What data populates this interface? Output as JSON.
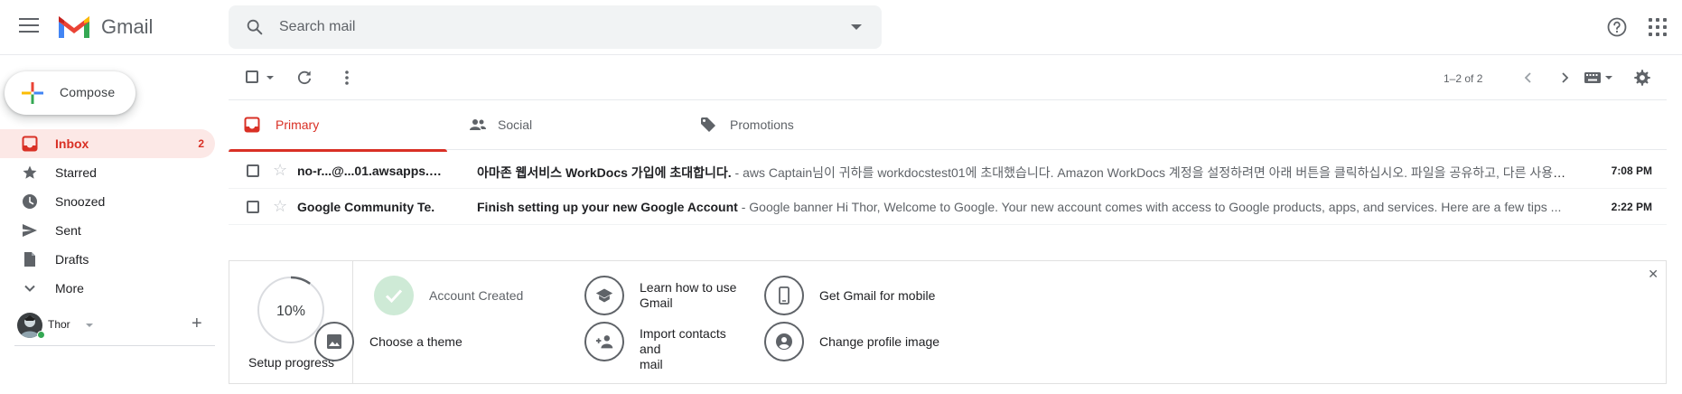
{
  "header": {
    "app_name": "Gmail",
    "search_placeholder": "Search mail",
    "icons": [
      "menu-icon",
      "gmail-logo",
      "search-icon",
      "search-options-icon",
      "help-icon",
      "apps-icon"
    ]
  },
  "compose": {
    "label": "Compose"
  },
  "sidebar": {
    "items": [
      {
        "label": "Inbox",
        "count": "2",
        "icon": "inbox-icon",
        "active": true
      },
      {
        "label": "Starred",
        "count": "",
        "icon": "star-icon"
      },
      {
        "label": "Snoozed",
        "count": "",
        "icon": "clock-icon"
      },
      {
        "label": "Sent",
        "count": "",
        "icon": "send-icon"
      },
      {
        "label": "Drafts",
        "count": "",
        "icon": "draft-icon"
      },
      {
        "label": "More",
        "count": "",
        "icon": "chevron-down-icon"
      }
    ]
  },
  "account": {
    "name": "Thor"
  },
  "toolbar": {
    "pager": "1–2 of 2"
  },
  "tabs": [
    {
      "label": "Primary",
      "icon": "inbox-icon",
      "active": true
    },
    {
      "label": "Social",
      "icon": "people-icon"
    },
    {
      "label": "Promotions",
      "icon": "tag-icon"
    }
  ],
  "emails": [
    {
      "sender": "no-r...@...01.awsapps.c...",
      "subject": "아마존 웹서비스 WorkDocs 가입에 초대합니다.",
      "snippet": "aws Captain님이 귀하를 workdocstest01에 초대했습니다. Amazon WorkDocs 계정을 설정하려면 아래 버튼을 클릭하십시오. 파일을 공유하고, 다른 사용자의 ...",
      "time": "7:08 PM"
    },
    {
      "sender": "Google Community Te.",
      "subject": "Finish setting up your new Google Account",
      "snippet": "Google banner Hi Thor, Welcome to Google. Your new account comes with access to Google products, apps, and services. Here are a few tips ...",
      "time": "2:22 PM"
    }
  ],
  "setup": {
    "progress_value": "10%",
    "progress_fraction": 0.1,
    "progress_label": "Setup progress",
    "tasks": [
      {
        "label": "Account Created",
        "icon": "check-icon",
        "done": true
      },
      {
        "label": "Learn how to use\nGmail",
        "icon": "school-icon"
      },
      {
        "label": "Get Gmail for mobile",
        "icon": "phone-icon"
      },
      {
        "label": "Choose a theme",
        "icon": "image-icon"
      },
      {
        "label": "Import contacts and\nmail",
        "icon": "person-add-icon"
      },
      {
        "label": "Change profile image",
        "icon": "account-circle-icon"
      }
    ]
  },
  "colors": {
    "accent_red": "#d93025",
    "active_bg": "#fce8e6",
    "done_green": "#ceead6",
    "presence_green": "#34a853"
  }
}
